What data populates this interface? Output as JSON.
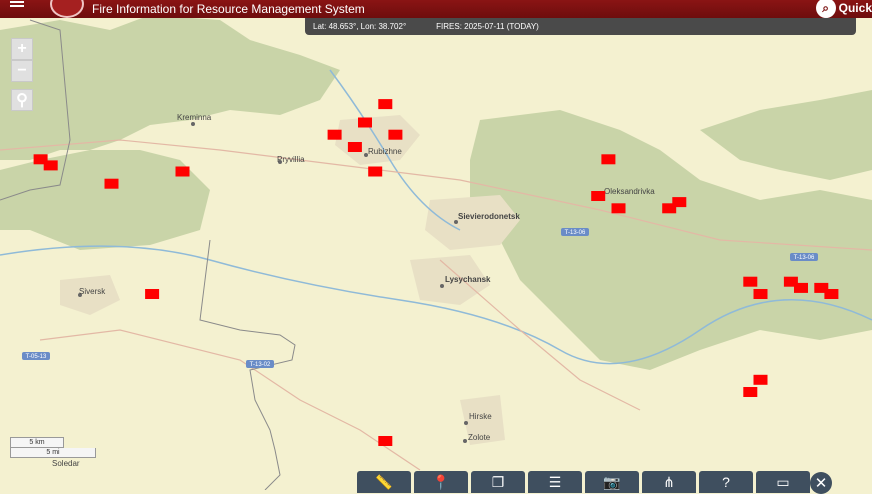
{
  "header": {
    "title": "Fire Information for Resource Management System",
    "quick_label": "Quick"
  },
  "status": {
    "coords": "Lat: 48.653°, Lon: 38.702°",
    "fires": "FIRES: 2025-07-11 (TODAY)"
  },
  "map_controls": {
    "zoom_in": "+",
    "zoom_out": "−"
  },
  "scale": {
    "km": "5 km",
    "mi": "5 mi"
  },
  "places": {
    "kreminna": "Kreminna",
    "rubizhne": "Rubizhne",
    "pryvillia": "Pryvillia",
    "sievierodonetsk": "Sievierodonetsk",
    "lysychansk": "Lysychansk",
    "oleksandrivka": "Oleksandrivka",
    "siversk": "Siversk",
    "hirske": "Hirske",
    "zolote": "Zolote",
    "soledar": "Soledar"
  },
  "roads": {
    "t1306a": "T-13-06",
    "t1306b": "T-13-06",
    "t0513": "T-05-13",
    "t1302": "T-13-02"
  },
  "colors": {
    "header": "#7a1010",
    "fire": "#ff0000",
    "land": "#f4f1d0",
    "forest": "#c7d3a6",
    "urban": "#e9e2c8",
    "toolbar": "#3f4f5f"
  },
  "fires": [
    {
      "lon": 38.04,
      "lat": 49.05
    },
    {
      "lon": 38.05,
      "lat": 49.045
    },
    {
      "lon": 38.11,
      "lat": 49.03
    },
    {
      "lon": 38.18,
      "lat": 49.04
    },
    {
      "lon": 38.33,
      "lat": 49.07
    },
    {
      "lon": 38.35,
      "lat": 49.06
    },
    {
      "lon": 38.36,
      "lat": 49.08
    },
    {
      "lon": 38.39,
      "lat": 49.07
    },
    {
      "lon": 38.38,
      "lat": 49.095
    },
    {
      "lon": 38.37,
      "lat": 49.04
    },
    {
      "lon": 38.6,
      "lat": 49.05
    },
    {
      "lon": 38.59,
      "lat": 49.02
    },
    {
      "lon": 38.61,
      "lat": 49.01
    },
    {
      "lon": 38.66,
      "lat": 49.01
    },
    {
      "lon": 38.67,
      "lat": 49.015
    },
    {
      "lon": 38.74,
      "lat": 48.95
    },
    {
      "lon": 38.75,
      "lat": 48.94
    },
    {
      "lon": 38.78,
      "lat": 48.95
    },
    {
      "lon": 38.79,
      "lat": 48.945
    },
    {
      "lon": 38.81,
      "lat": 48.945
    },
    {
      "lon": 38.82,
      "lat": 48.94
    },
    {
      "lon": 38.75,
      "lat": 48.87
    },
    {
      "lon": 38.74,
      "lat": 48.86
    },
    {
      "lon": 38.15,
      "lat": 48.94
    },
    {
      "lon": 38.38,
      "lat": 48.82
    }
  ],
  "toolbar": {
    "measure": "measure",
    "location": "location",
    "layers": "layers",
    "filters": "filters",
    "snapshot": "snapshot",
    "share": "share",
    "help": "?",
    "display": "display"
  }
}
